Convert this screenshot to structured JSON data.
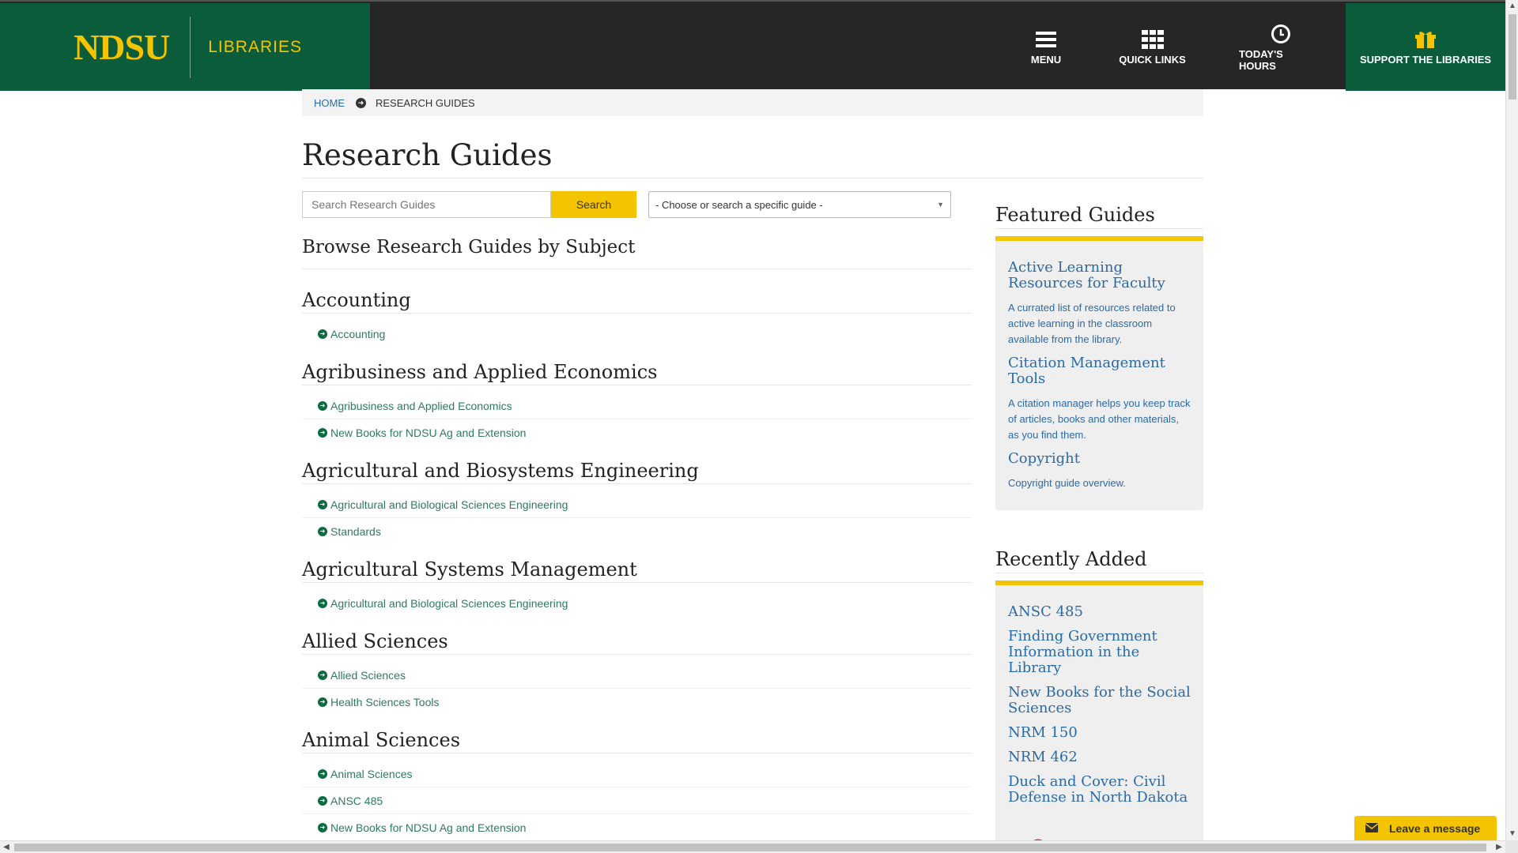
{
  "header": {
    "logo": "NDSU",
    "section": "LIBRARIES",
    "nav": {
      "menu": "MENU",
      "quick_links": "QUICK LINKS",
      "todays_hours": "TODAY'S HOURS",
      "support": "SUPPORT THE LIBRARIES"
    }
  },
  "breadcrumb": {
    "home": "HOME",
    "current": "RESEARCH GUIDES"
  },
  "page_title": "Research Guides",
  "search": {
    "placeholder": "Search Research Guides",
    "button": "Search",
    "select_value": "- Choose or search a specific guide -"
  },
  "browse_heading": "Browse Research Guides by Subject",
  "subjects": [
    {
      "name": "Accounting",
      "guides": [
        "Accounting"
      ]
    },
    {
      "name": "Agribusiness and Applied Economics",
      "guides": [
        "Agribusiness and Applied Economics",
        "New Books for NDSU Ag and Extension"
      ]
    },
    {
      "name": "Agricultural and Biosystems Engineering",
      "guides": [
        "Agricultural and Biological Sciences Engineering",
        "Standards"
      ]
    },
    {
      "name": "Agricultural Systems Management",
      "guides": [
        "Agricultural and Biological Sciences Engineering"
      ]
    },
    {
      "name": "Allied Sciences",
      "guides": [
        "Allied Sciences",
        "Health Sciences Tools"
      ]
    },
    {
      "name": "Animal Sciences",
      "guides": [
        "Animal Sciences",
        "ANSC 485",
        "New Books for NDSU Ag and Extension"
      ]
    }
  ],
  "featured": {
    "heading": "Featured Guides",
    "items": [
      {
        "title": "Active Learning Resources for Faculty",
        "desc": "A currated list of resources related to active learning in the classroom available from the library."
      },
      {
        "title": "Citation Management Tools",
        "desc": "A citation manager helps you keep track of articles, books and other materials, as you find them."
      },
      {
        "title": "Copyright",
        "desc": "Copyright guide overview."
      }
    ]
  },
  "recent": {
    "heading": "Recently Added",
    "items": [
      "ANSC 485",
      "Finding Government Information in the Library",
      "New Books for the Social Sciences",
      "NRM 150",
      "NRM 462",
      "Duck and Cover: Civil Defense in North Dakota"
    ]
  },
  "chat": {
    "label": "Leave a message"
  },
  "colors": {
    "brand_green": "#0b5c3a",
    "gold": "#f5c400",
    "header_dark": "#262626",
    "link_blue": "#2a6aa5",
    "link_green": "#2f7a5d"
  }
}
